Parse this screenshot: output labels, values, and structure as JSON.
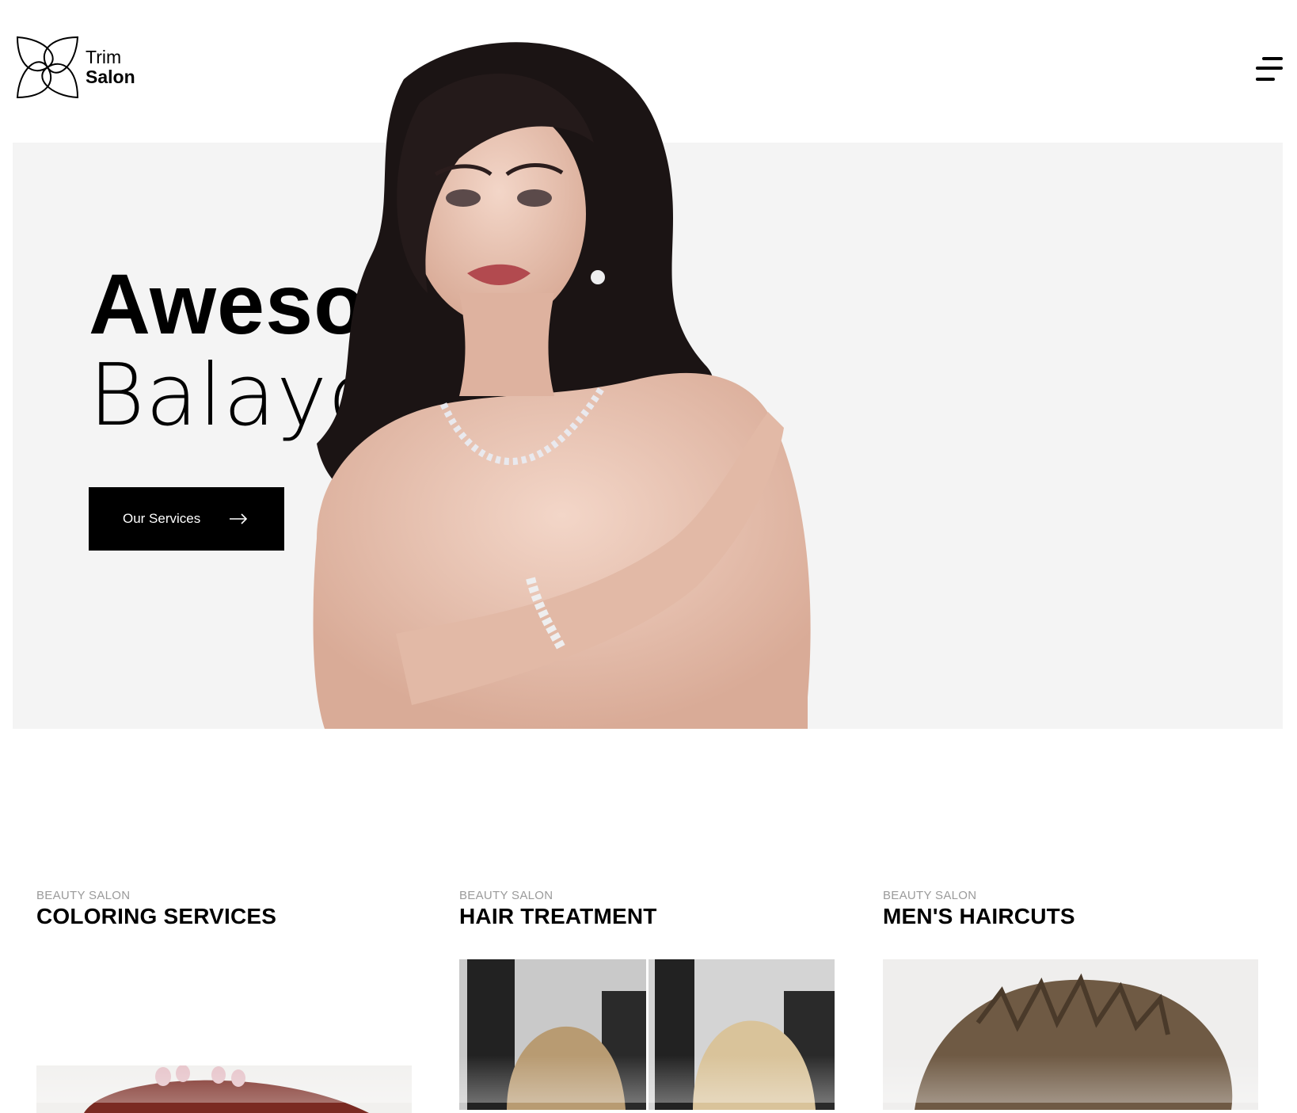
{
  "header": {
    "logo_line1": "Trim",
    "logo_line2": "Salon",
    "logo_icon": "flower-outline-icon",
    "menu_icon": "hamburger-menu-icon"
  },
  "hero": {
    "title_bold": "Aweso",
    "title_light": "Balayo",
    "cta_label": "Our Services",
    "cta_icon": "arrow-right-icon",
    "background": "#f4f4f4"
  },
  "services": [
    {
      "kicker": "BEAUTY SALON",
      "title": "COLORING SERVICES"
    },
    {
      "kicker": "BEAUTY SALON",
      "title": "HAIR TREATMENT"
    },
    {
      "kicker": "BEAUTY SALON",
      "title": "MEN'S HAIRCUTS"
    }
  ],
  "colors": {
    "primary": "#000000",
    "muted": "#9a9a9a",
    "panel": "#f4f4f4"
  }
}
